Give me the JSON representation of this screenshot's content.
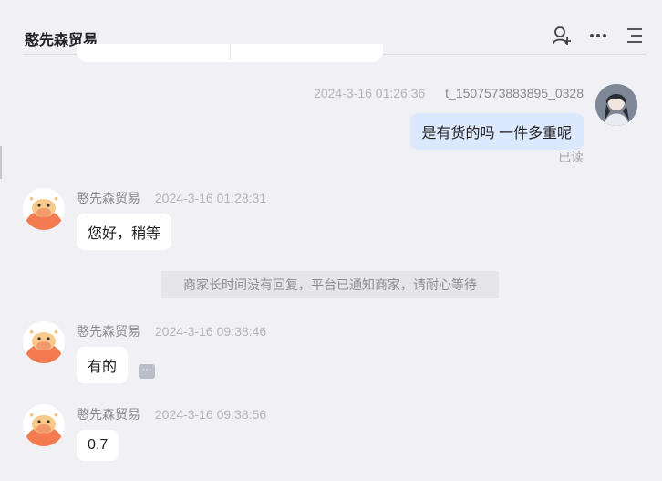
{
  "header": {
    "title": "憨先森贸易",
    "icons": [
      "add-user-icon",
      "more-icon",
      "menu-list-icon"
    ]
  },
  "self_message": {
    "time": "2024-3-16 01:26:36",
    "user_id": "t_1507573883895_0328",
    "text": "是有货的吗 一件多重呢",
    "status": "已读"
  },
  "messages": [
    {
      "name": "憨先森贸易",
      "time": "2024-3-16 01:28:31",
      "text": "您好，稍等"
    },
    {
      "name": "憨先森贸易",
      "time": "2024-3-16 09:38:46",
      "text": "有的"
    },
    {
      "name": "憨先森贸易",
      "time": "2024-3-16 09:38:56",
      "text": "0.7"
    }
  ],
  "system_notice": "商家长时间没有回复，平台已通知商家，请耐心等待",
  "colors": {
    "background": "#f0f0f5",
    "self_bubble": "#dce8fd",
    "bubble": "#ffffff",
    "avatar_orange": "#f47a50"
  }
}
